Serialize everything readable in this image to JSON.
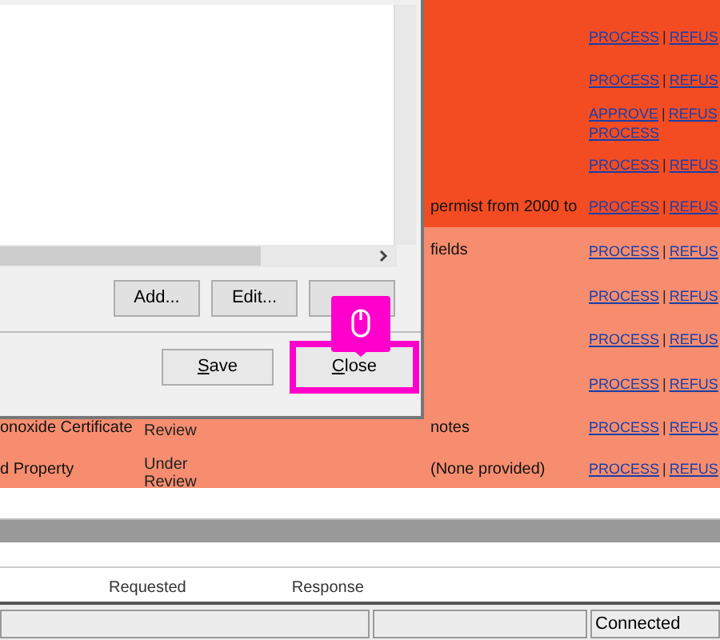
{
  "table": {
    "rows": [
      {
        "color": "#f44c22",
        "actions": [
          [
            {
              "kind": "link",
              "text": "PROCESS"
            },
            {
              "kind": "separator",
              "text": "|"
            },
            {
              "kind": "link",
              "text": "REFUS"
            }
          ]
        ]
      },
      {
        "color": "#f44c22",
        "actions": [
          [
            {
              "kind": "link",
              "text": "PROCESS"
            },
            {
              "kind": "separator",
              "text": "|"
            },
            {
              "kind": "link",
              "text": "REFUS"
            }
          ]
        ]
      },
      {
        "color": "#f44c22",
        "actions": [
          [
            {
              "kind": "link",
              "text": "APPROVE"
            },
            {
              "kind": "separator",
              "text": "|"
            },
            {
              "kind": "link",
              "text": "REFUS"
            }
          ],
          [
            {
              "kind": "link",
              "text": "PROCESS"
            }
          ]
        ]
      },
      {
        "color": "#f44c22",
        "actions": [
          [
            {
              "kind": "link",
              "text": "PROCESS"
            },
            {
              "kind": "separator",
              "text": "|"
            },
            {
              "kind": "link",
              "text": "REFUS"
            }
          ]
        ]
      },
      {
        "color": "#f44c22",
        "column_3": "permist from 2000 to",
        "actions": [
          [
            {
              "kind": "link",
              "text": "PROCESS"
            },
            {
              "kind": "separator",
              "text": "|"
            },
            {
              "kind": "link",
              "text": "REFUS"
            }
          ]
        ]
      },
      {
        "color": "#f68d6f",
        "column_3": "fields",
        "actions": [
          [
            {
              "kind": "link",
              "text": "PROCESS"
            },
            {
              "kind": "separator",
              "text": "|"
            },
            {
              "kind": "link",
              "text": "REFUS"
            }
          ]
        ]
      },
      {
        "color": "#f68d6f",
        "actions": [
          [
            {
              "kind": "link",
              "text": "PROCESS"
            },
            {
              "kind": "separator",
              "text": "|"
            },
            {
              "kind": "link",
              "text": "REFUS"
            }
          ]
        ]
      },
      {
        "color": "#f68d6f",
        "actions": [
          [
            {
              "kind": "link",
              "text": "PROCESS"
            },
            {
              "kind": "separator",
              "text": "|"
            },
            {
              "kind": "link",
              "text": "REFUS"
            }
          ]
        ]
      },
      {
        "color": "#f68d6f",
        "actions": [
          [
            {
              "kind": "link",
              "text": "PROCESS"
            },
            {
              "kind": "separator",
              "text": "|"
            },
            {
              "kind": "link",
              "text": "REFUS"
            }
          ]
        ]
      },
      {
        "color": "#f68d6f",
        "column_1": "onoxide Certificate",
        "column_2": "Review",
        "column_3": "notes",
        "actions": [
          [
            {
              "kind": "link",
              "text": "PROCESS"
            },
            {
              "kind": "separator",
              "text": "|"
            },
            {
              "kind": "link",
              "text": "REFUS"
            }
          ]
        ]
      },
      {
        "color": "#f68d6f",
        "column_1": "d Property",
        "column_2": "Under Review",
        "column_3": "(None provided)",
        "actions": [
          [
            {
              "kind": "link",
              "text": "PROCESS"
            },
            {
              "kind": "separator",
              "text": "|"
            },
            {
              "kind": "link",
              "text": "REFUS"
            }
          ]
        ]
      }
    ]
  },
  "lower_table": {
    "headers": [
      "Requested",
      "Response"
    ]
  },
  "dialog": {
    "list_buttons": [
      {
        "label": "Add..."
      },
      {
        "label": "Edit..."
      }
    ],
    "buttons": [
      {
        "label": "Save",
        "accelerator": true,
        "highlighted": false
      },
      {
        "label": "Close",
        "accelerator": true,
        "highlighted": true
      }
    ]
  },
  "status_bar": {
    "connection": "Connected"
  }
}
